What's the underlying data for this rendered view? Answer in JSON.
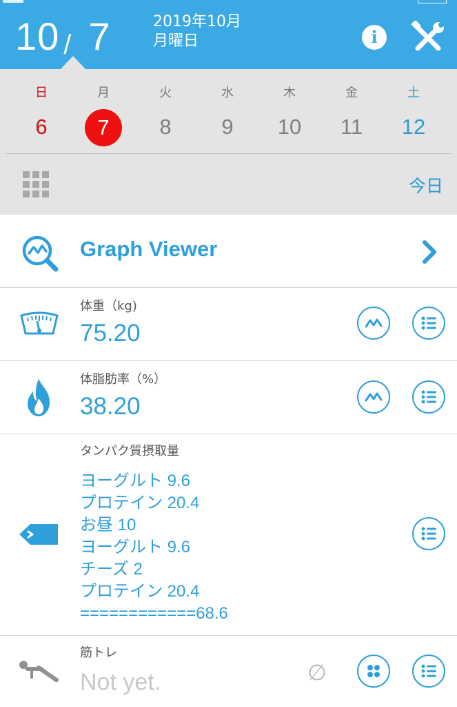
{
  "header": {
    "month": "10",
    "slash": "/",
    "day": "7",
    "year_month": "2019年10月",
    "weekday": "月曜日",
    "info_label": "i"
  },
  "week": {
    "days": [
      {
        "weekday": "日",
        "date": "6"
      },
      {
        "weekday": "月",
        "date": "7"
      },
      {
        "weekday": "火",
        "date": "8"
      },
      {
        "weekday": "水",
        "date": "9"
      },
      {
        "weekday": "木",
        "date": "10"
      },
      {
        "weekday": "金",
        "date": "11"
      },
      {
        "weekday": "土",
        "date": "12"
      }
    ],
    "selected_index": 1,
    "today_label": "今日"
  },
  "graph_viewer": {
    "title": "Graph Viewer"
  },
  "weight": {
    "label": "体重（kg)",
    "value": "75.20"
  },
  "body_fat": {
    "label": "体脂肪率（%）",
    "value": "38.20"
  },
  "protein": {
    "label": "タンパク質摂取量",
    "lines": [
      "ヨーグルト 9.6",
      "プロテイン 20.4",
      "お昼 10",
      "ヨーグルト 9.6",
      "チーズ 2",
      "プロテイン 20.4",
      "============68.6"
    ]
  },
  "training": {
    "label": "筋トレ",
    "value": "Not yet.",
    "empty_symbol": "∅"
  },
  "colors": {
    "header_bg": "#3aa9e4",
    "accent": "#2f9fdc",
    "sunday": "#c9151b",
    "saturday": "#2a9ad6",
    "today_circle": "#ee1010",
    "week_bg": "#e4e4e4"
  },
  "icons": {
    "tools": "wrench-screwdriver-icon",
    "info": "info-icon",
    "graph": "magnifier-graph-icon",
    "scale": "scale-icon",
    "flame": "flame-icon",
    "tag": "tag-icon",
    "training": "bench-press-icon",
    "chart_button": "line-chart-icon",
    "list_button": "list-icon",
    "chevron": "chevron-right-icon",
    "grid": "grid-icon"
  }
}
